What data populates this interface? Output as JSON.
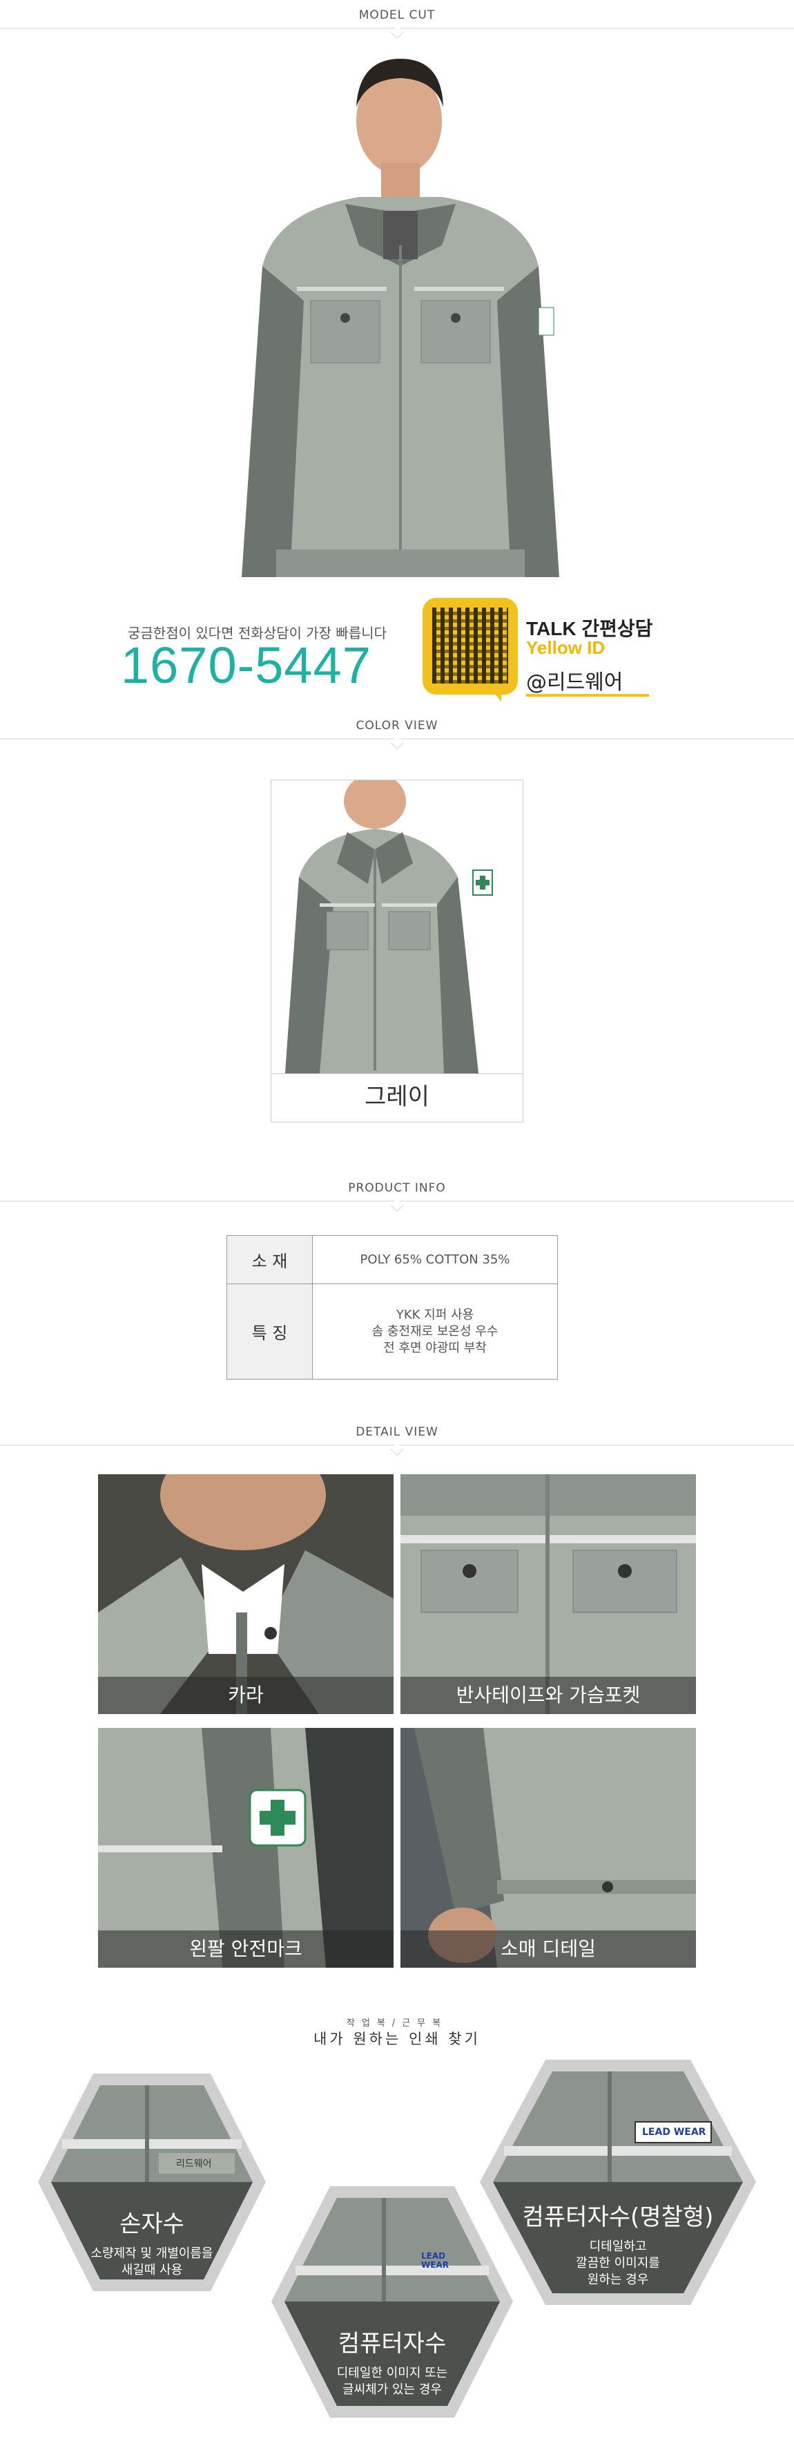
{
  "sections": {
    "model_cut": "MODEL CUT",
    "color_view": "COLOR VIEW",
    "product_info": "PRODUCT INFO",
    "detail_view": "DETAIL VIEW"
  },
  "contact": {
    "note": "궁금한점이 있다면 전화상담이 가장 빠릅니다",
    "phone": "1670-5447",
    "talk_title": "TALK 간편상담",
    "talk_sub": "Yellow ID",
    "talk_id": "@리드웨어"
  },
  "color_option": "그레이",
  "spec": {
    "material_label": "소 재",
    "material_value": "POLY 65% COTTON 35%",
    "feature_label": "특 징",
    "features": [
      "YKK 지퍼 사용",
      "솜 충전재로 보온성 우수",
      "전 후면 야광띠 부착"
    ]
  },
  "details": [
    "카라",
    "반사테이프와 가슴포켓",
    "왼팔 안전마크",
    "소매 디테일"
  ],
  "find": {
    "small": "작업복/근무복",
    "big": "내가 원하는 인쇄 찾기"
  },
  "print_options": [
    {
      "title": "손자수",
      "desc": [
        "소량제작 및 개별이름을",
        "새길때 사용"
      ],
      "patch": "리드웨어"
    },
    {
      "title": "컴퓨터자수",
      "desc": [
        "디테일한 이미지 또는",
        "글씨체가 있는 경우"
      ],
      "patch": "LEAD WEAR"
    },
    {
      "title": "컴퓨터자수(명찰형)",
      "desc": [
        "디테일하고",
        "깔끔한 이미지를",
        "원하는 경우"
      ],
      "patch": "LEAD WEAR"
    }
  ],
  "colors": {
    "accent_teal": "#1bb2a3",
    "kakao_yellow": "#f2c11b",
    "jacket_light": "#a6ada5",
    "jacket_dark": "#6d736d"
  }
}
